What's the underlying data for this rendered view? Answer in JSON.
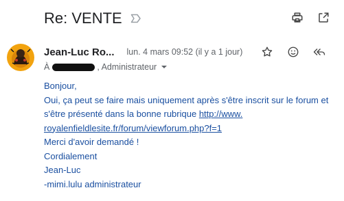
{
  "email": {
    "subject": "Re: VENTE",
    "sender_name": "Jean-Luc Ro...",
    "date": "lun. 4 mars 09:52 (il y a 1 jour)",
    "to_prefix": "À",
    "to_suffix": ", Administrateur",
    "body": {
      "line1": "Bonjour,",
      "line2": "Oui, ça peut se faire mais uniquement après s'être inscrit sur le forum et",
      "line3_text": "s'être présenté dans la bonne rubrique ",
      "link_part1": "http://www.",
      "link_part2": "royalenfieldlesite.fr/forum/viewforum.php?f=1",
      "line5": "Merci d'avoir demandé !",
      "line6": "Cordialement",
      "line7": "Jean-Luc",
      "line8": "-mimi.lulu administrateur"
    }
  },
  "icons": {
    "label": "label-outline-icon",
    "print": "print-icon",
    "open_new": "open-in-new-icon",
    "star": "star-icon",
    "emoji": "emoji-icon",
    "reply_all": "reply-all-icon",
    "caret": "caret-down-icon"
  },
  "colors": {
    "subject": "#202124",
    "secondary_text": "#5f6368",
    "body_text": "#1a4fa0",
    "avatar_bg": "#f2a30f"
  }
}
